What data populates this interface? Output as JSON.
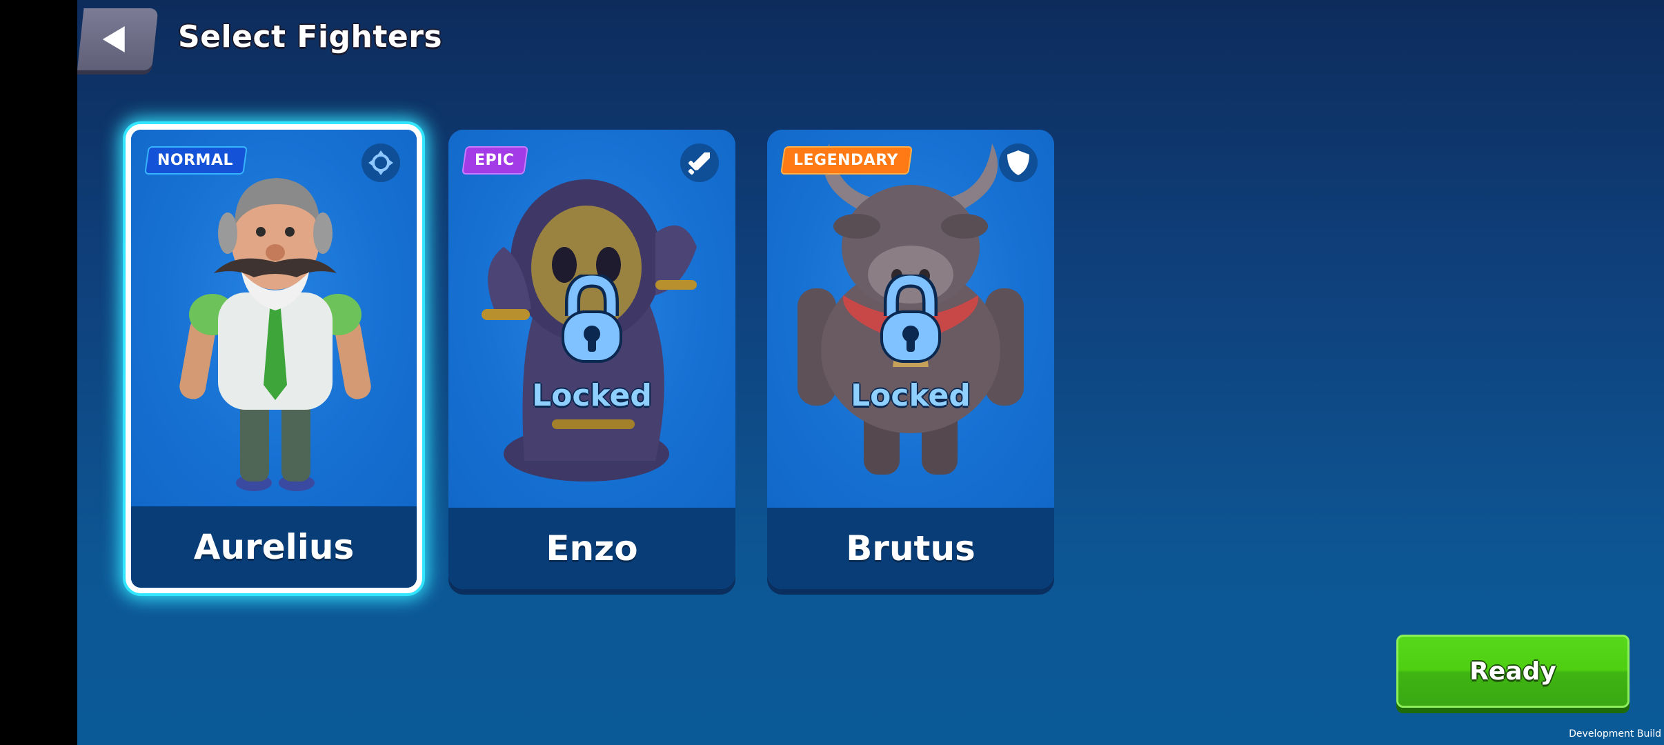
{
  "header": {
    "title": "Select Fighters"
  },
  "fighters": [
    {
      "name": "Aurelius",
      "rarity": "NORMAL",
      "class_icon": "crosshair-icon",
      "locked": false,
      "selected": true,
      "locked_label": ""
    },
    {
      "name": "Enzo",
      "rarity": "EPIC",
      "class_icon": "sword-icon",
      "locked": true,
      "selected": false,
      "locked_label": "Locked"
    },
    {
      "name": "Brutus",
      "rarity": "LEGENDARY",
      "class_icon": "shield-icon",
      "locked": true,
      "selected": false,
      "locked_label": "Locked"
    }
  ],
  "actions": {
    "ready_label": "Ready"
  },
  "footer": {
    "build_label": "Development Build"
  },
  "colors": {
    "selected_glow": "#34e6ff",
    "normal_badge": "#1452d8",
    "epic_badge": "#a33ce6",
    "legendary_badge": "#ff7a14",
    "ready_green": "#4fcf12"
  }
}
